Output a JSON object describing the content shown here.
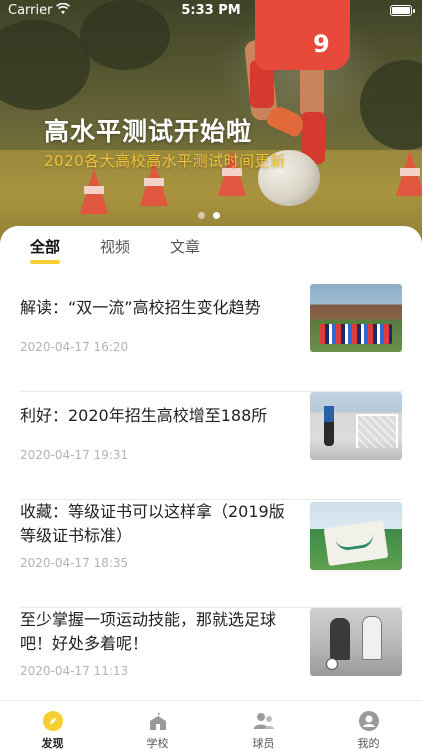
{
  "status_bar": {
    "carrier": "Carrier",
    "time": "5:33 PM"
  },
  "banner": {
    "title": "高水平测试开始啦",
    "subtitle": "2020各大高校高水平测试时间更新",
    "jersey_number": "9",
    "pages": 2,
    "active_page": 2
  },
  "tabs": [
    {
      "label": "全部",
      "active": true
    },
    {
      "label": "视频",
      "active": false
    },
    {
      "label": "文章",
      "active": false
    }
  ],
  "articles": [
    {
      "title": "解读：“双一流”高校招生变化趋势",
      "date": "2020-04-17 16:20",
      "thumb": "campus-field-photo"
    },
    {
      "title": "利好：2020年招生高校增至188所",
      "date": "2020-04-17 19:31",
      "thumb": "kid-at-goal-photo"
    },
    {
      "title": "收藏：等级证书可以这样拿（2019版等级证书标准）",
      "date": "2020-04-17 18:35",
      "thumb": "banner-on-pitch-photo"
    },
    {
      "title": "至少掌握一项运动技能，那就选足球吧！好处多着呢！",
      "date": "2020-04-17 11:13",
      "thumb": "vintage-match-photo"
    }
  ],
  "bottom_nav": [
    {
      "label": "发现",
      "icon": "compass-icon",
      "active": true
    },
    {
      "label": "学校",
      "icon": "school-icon",
      "active": false
    },
    {
      "label": "球员",
      "icon": "players-icon",
      "active": false
    },
    {
      "label": "我的",
      "icon": "profile-icon",
      "active": false
    }
  ],
  "colors": {
    "accent": "#f6d033",
    "banner_subtitle": "#f3c33a",
    "date_text": "#b3b3b3"
  }
}
